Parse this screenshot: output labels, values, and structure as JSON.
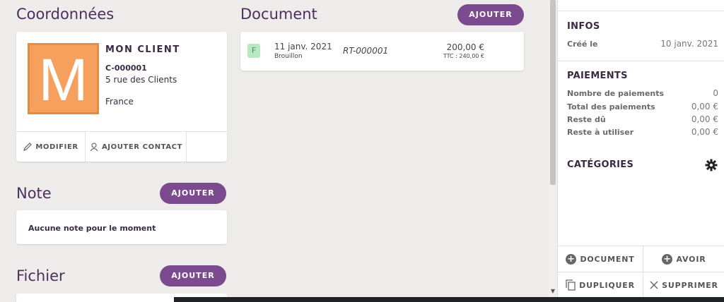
{
  "coordonnees": {
    "title": "Coordonnées",
    "client": {
      "initial": "M",
      "name": "MON CLIENT",
      "code": "C-000001",
      "address": "5 rue des Clients",
      "country": "France"
    },
    "actions": {
      "modify_label": "MODIFIER",
      "add_contact_label": "AJOUTER CONTACT"
    }
  },
  "note": {
    "title": "Note",
    "add_label": "AJOUTER",
    "empty_text": "Aucune note pour le moment"
  },
  "fichier": {
    "title": "Fichier",
    "add_label": "AJOUTER"
  },
  "document": {
    "title": "Document",
    "add_label": "AJOUTER",
    "rows": [
      {
        "badge": "F",
        "date": "11 janv. 2021",
        "status": "Brouillon",
        "reference": "RT-000001",
        "amount": "200,00 €",
        "ttc": "TTC : 240,00 €"
      }
    ]
  },
  "sidebar": {
    "infos": {
      "title": "INFOS",
      "created_label": "Créé le",
      "created_value": "10 janv. 2021"
    },
    "paiements": {
      "title": "PAIEMENTS",
      "items": [
        {
          "label": "Nombre de paiements",
          "value": "0"
        },
        {
          "label": "Total des paiements",
          "value": "0,00 €"
        },
        {
          "label": "Reste dû",
          "value": "0,00 €"
        },
        {
          "label": "Reste à utiliser",
          "value": "0,00 €"
        }
      ]
    },
    "categories": {
      "title": "CATÉGORIES"
    },
    "buttons": {
      "document_label": "DOCUMENT",
      "avoir_label": "AVOIR",
      "dupliquer_label": "DUPLIQUER",
      "supprimer_label": "SUPPRIMER"
    }
  },
  "colors": {
    "accent": "#7c4a8e",
    "avatar": "#f5a05c",
    "badge": "#b7e8c1"
  }
}
